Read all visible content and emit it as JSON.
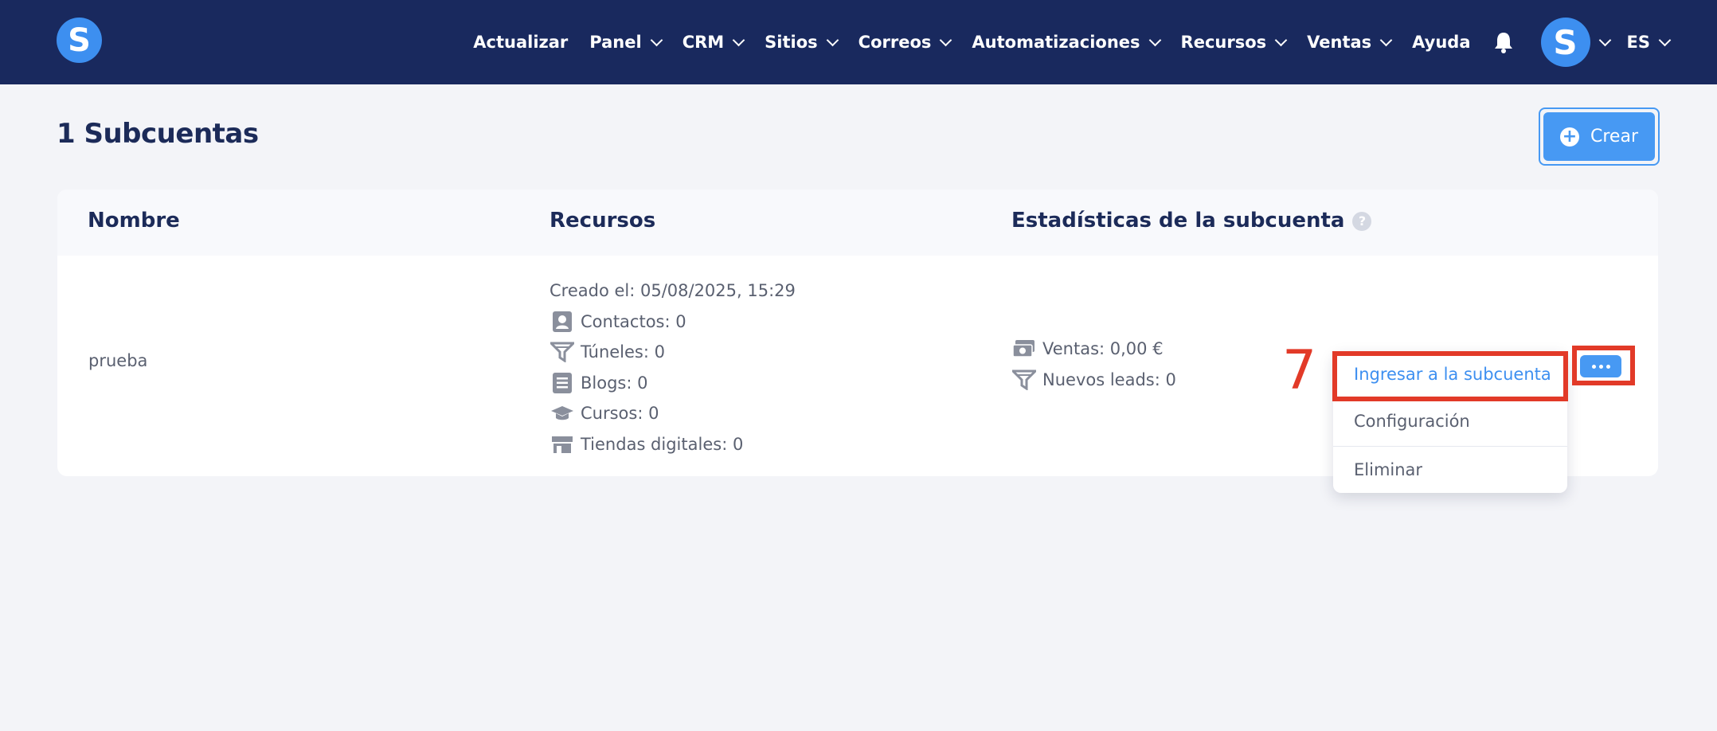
{
  "nav": {
    "logo_letter": "S",
    "items": [
      {
        "label": "Actualizar",
        "dropdown": false
      },
      {
        "label": "Panel",
        "dropdown": true
      },
      {
        "label": "CRM",
        "dropdown": true
      },
      {
        "label": "Sitios",
        "dropdown": true
      },
      {
        "label": "Correos",
        "dropdown": true
      },
      {
        "label": "Automatizaciones",
        "dropdown": true
      },
      {
        "label": "Recursos",
        "dropdown": true
      },
      {
        "label": "Ventas",
        "dropdown": true
      },
      {
        "label": "Ayuda",
        "dropdown": false
      }
    ],
    "bell_icon": "bell-icon",
    "avatar_letter": "S",
    "language": "ES"
  },
  "page": {
    "title": "1 Subcuentas",
    "create_label": "Crear"
  },
  "table": {
    "headers": {
      "name": "Nombre",
      "resources": "Recursos",
      "stats": "Estadísticas de la subcuenta",
      "help": "?"
    },
    "rows": [
      {
        "name": "prueba",
        "created": "Creado el: 05/08/2025, 15:29",
        "resources": [
          {
            "icon": "contact-icon",
            "label": "Contactos: 0"
          },
          {
            "icon": "funnel-icon",
            "label": "Túneles: 0"
          },
          {
            "icon": "document-icon",
            "label": "Blogs: 0"
          },
          {
            "icon": "graduation-cap-icon",
            "label": "Cursos: 0"
          },
          {
            "icon": "store-icon",
            "label": "Tiendas digitales: 0"
          }
        ],
        "stats": [
          {
            "icon": "money-icon",
            "label": "Ventas: 0,00 €"
          },
          {
            "icon": "funnel-icon",
            "label": "Nuevos leads: 0"
          }
        ]
      }
    ]
  },
  "menu": {
    "items": [
      {
        "label": "Ingresar a la subcuenta",
        "active": true
      },
      {
        "label": "Configuración",
        "active": false
      },
      {
        "label": "Eliminar",
        "active": false
      }
    ]
  },
  "annotation": {
    "step_number": "7",
    "color": "#e23a28"
  },
  "colors": {
    "nav_bg": "#19295e",
    "accent": "#4799f3",
    "heading": "#1c2b59",
    "text_muted": "#5a6070"
  }
}
